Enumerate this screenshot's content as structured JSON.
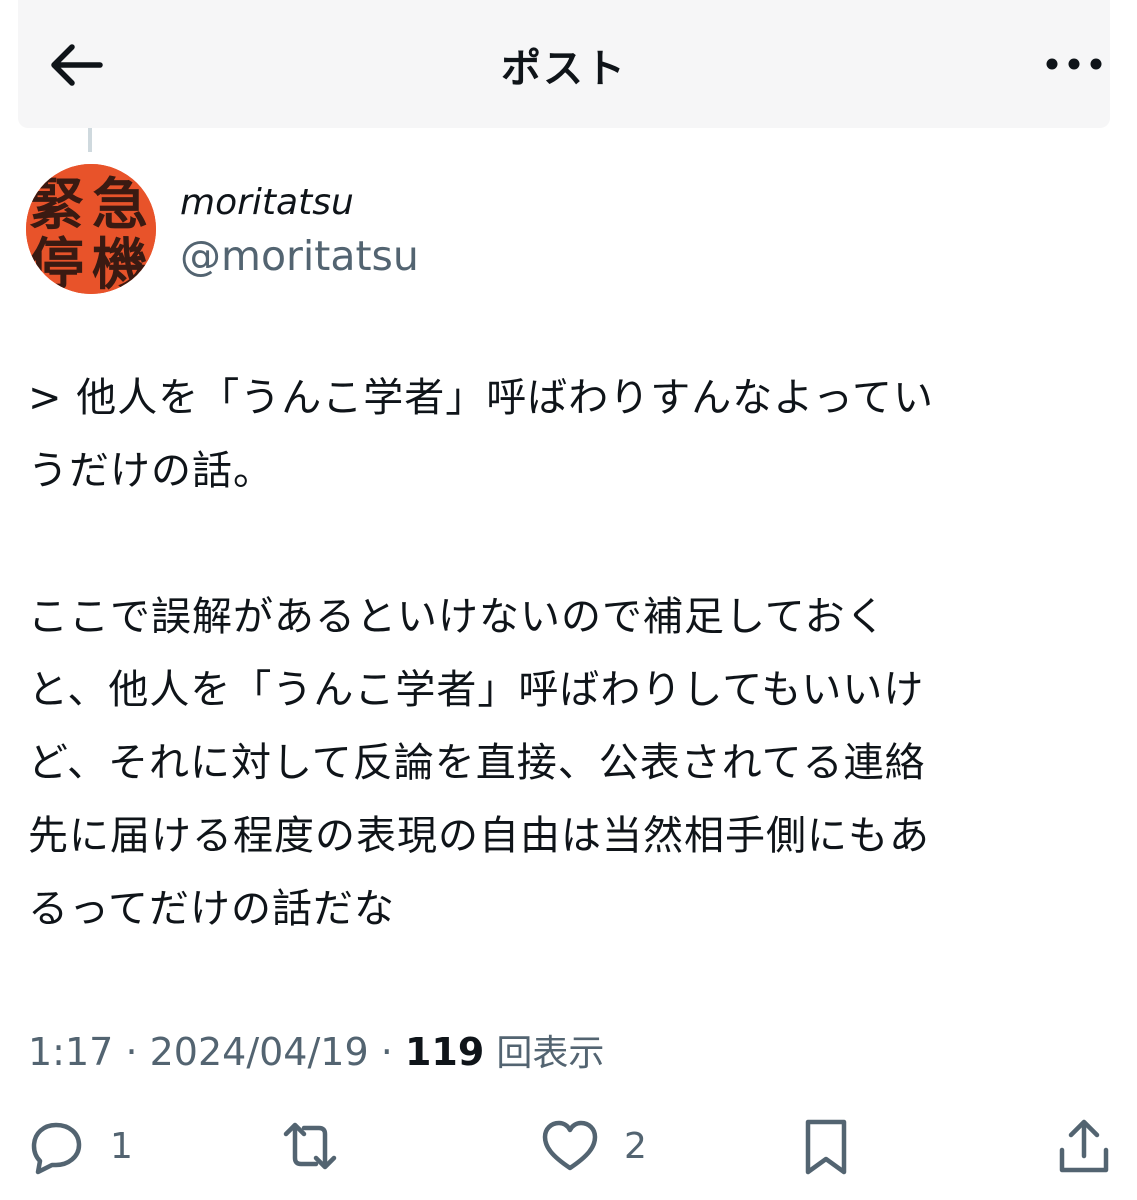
{
  "header": {
    "title": "ポスト",
    "back_icon": "arrow-left-icon",
    "more_icon": "more-horizontal-icon"
  },
  "author": {
    "name": "moritatsu",
    "handle": "@moritatsu",
    "avatar_text": "緊急停機",
    "avatar_color": "#e8532a"
  },
  "post": {
    "lines_a": [
      "> 他人を「うんこ学者」呼ばわりすんなよってい",
      "うだけの話。"
    ],
    "lines_b": [
      "ここで誤解があるといけないので補足しておく",
      "と、他人を「うんこ学者」呼ばわりしてもいいけ",
      "ど、それに対して反論を直接、公表されてる連絡",
      "先に届ける程度の表現の自由は当然相手側にもあ",
      "るってだけの話だな"
    ]
  },
  "meta": {
    "time": "1:17",
    "separator": "·",
    "date": "2024/04/19",
    "views_count": "119",
    "views_label": "回表示"
  },
  "actions": {
    "reply_count": "1",
    "repost_count": "",
    "like_count": "2",
    "reply_icon": "reply-icon",
    "repost_icon": "repost-icon",
    "like_icon": "heart-icon",
    "bookmark_icon": "bookmark-icon",
    "share_icon": "share-icon"
  },
  "colors": {
    "text_primary": "#0f1419",
    "text_secondary": "#536471",
    "header_bg": "#f6f6f7"
  }
}
